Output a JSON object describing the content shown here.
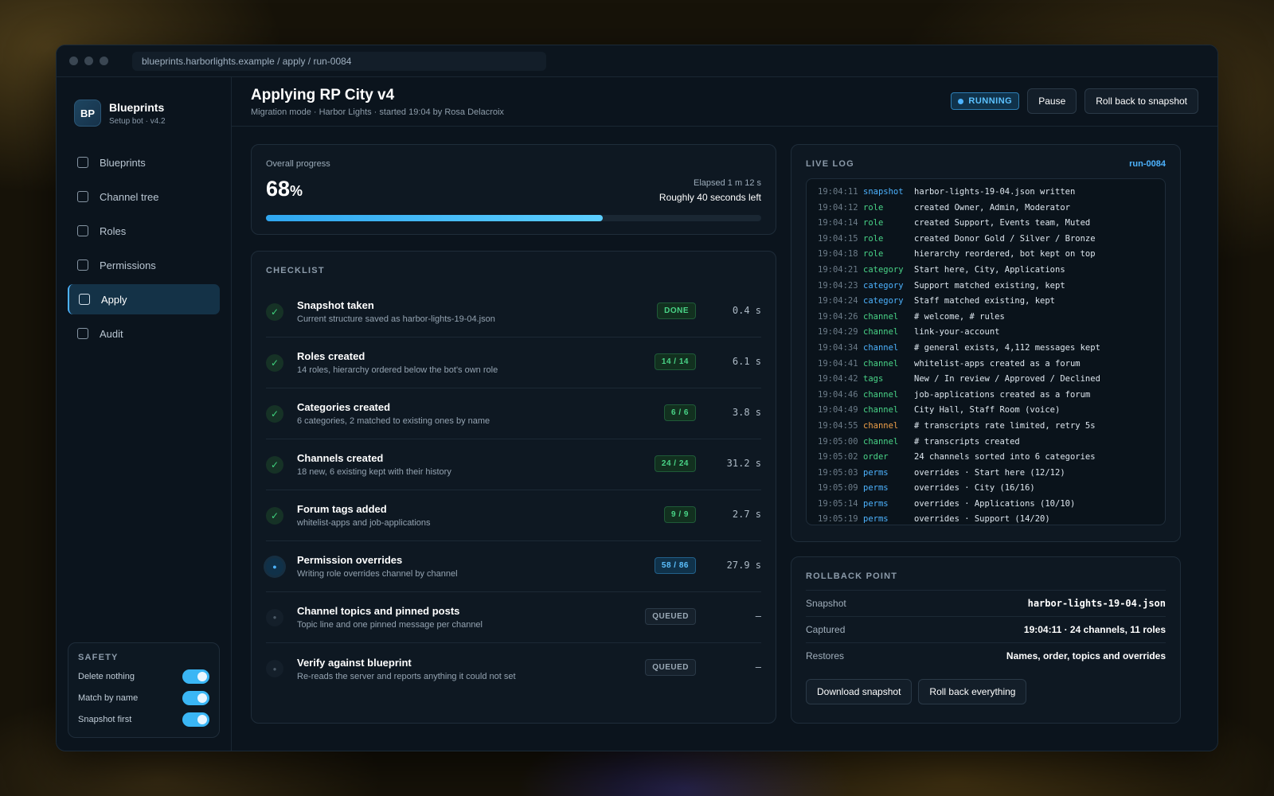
{
  "browser": {
    "url": "blueprints.harborlights.example / apply / run-0084"
  },
  "brand": {
    "logo": "BP",
    "name": "Blueprints",
    "subtitle": "Setup bot · v4.2"
  },
  "nav": [
    {
      "label": "Blueprints",
      "icon": "square-icon",
      "active": false
    },
    {
      "label": "Channel tree",
      "icon": "square-icon",
      "active": false
    },
    {
      "label": "Roles",
      "icon": "square-icon",
      "active": false
    },
    {
      "label": "Permissions",
      "icon": "square-icon",
      "active": false
    },
    {
      "label": "Apply",
      "icon": "square-icon",
      "active": true
    },
    {
      "label": "Audit",
      "icon": "square-icon",
      "active": false
    }
  ],
  "safety": {
    "title": "SAFETY",
    "toggles": [
      {
        "label": "Delete nothing",
        "on": true
      },
      {
        "label": "Match by name",
        "on": true
      },
      {
        "label": "Snapshot first",
        "on": true
      }
    ]
  },
  "header": {
    "title": "Applying RP City v4",
    "subtitle": "Migration mode · Harbor Lights · started 19:04 by Rosa Delacroix",
    "status": "RUNNING",
    "pause_label": "Pause",
    "rollback_label": "Roll back to snapshot"
  },
  "progress": {
    "label": "Overall progress",
    "value": "68",
    "unit": "%",
    "fraction": 0.68,
    "elapsed": "Elapsed 1 m 12 s",
    "remaining": "Roughly 40 seconds left"
  },
  "checklist": {
    "title": "CHECKLIST",
    "items": [
      {
        "title": "Snapshot taken",
        "desc": "Current structure saved as harbor-lights-19-04.json",
        "pill": "DONE",
        "state": "done",
        "duration": "0.4 s"
      },
      {
        "title": "Roles created",
        "desc": "14 roles, hierarchy ordered below the bot's own role",
        "pill": "14 / 14",
        "state": "done",
        "duration": "6.1 s"
      },
      {
        "title": "Categories created",
        "desc": "6 categories, 2 matched to existing ones by name",
        "pill": "6 / 6",
        "state": "done",
        "duration": "3.8 s"
      },
      {
        "title": "Channels created",
        "desc": "18 new, 6 existing kept with their history",
        "pill": "24 / 24",
        "state": "done",
        "duration": "31.2 s"
      },
      {
        "title": "Forum tags added",
        "desc": "whitelist-apps and job-applications",
        "pill": "9 / 9",
        "state": "done",
        "duration": "2.7 s"
      },
      {
        "title": "Permission overrides",
        "desc": "Writing role overrides channel by channel",
        "pill": "58 / 86",
        "state": "running",
        "duration": "27.9 s"
      },
      {
        "title": "Channel topics and pinned posts",
        "desc": "Topic line and one pinned message per channel",
        "pill": "QUEUED",
        "state": "queued",
        "duration": "–"
      },
      {
        "title": "Verify against blueprint",
        "desc": "Re-reads the server and reports anything it could not set",
        "pill": "QUEUED",
        "state": "queued",
        "duration": "–"
      }
    ]
  },
  "log": {
    "title": "LIVE LOG",
    "run_id": "run-0084",
    "kind_colors": {
      "snapshot": "#4db3ff",
      "role": "#49d487",
      "category": "#4db3ff",
      "channel": "#49d487",
      "channel-warn": "#f0a048",
      "tags": "#49d487",
      "order": "#49d487",
      "perms": "#4db3ff"
    },
    "lines": [
      {
        "time": "19:04:11",
        "kind": "snapshot",
        "color": "snapshot",
        "msg": "harbor-lights-19-04.json written"
      },
      {
        "time": "19:04:12",
        "kind": "role",
        "color": "role",
        "msg": "created Owner, Admin, Moderator"
      },
      {
        "time": "19:04:14",
        "kind": "role",
        "color": "role",
        "msg": "created Support, Events team, Muted"
      },
      {
        "time": "19:04:15",
        "kind": "role",
        "color": "role",
        "msg": "created Donor Gold / Silver / Bronze"
      },
      {
        "time": "19:04:18",
        "kind": "role",
        "color": "role",
        "msg": "hierarchy reordered, bot kept on top"
      },
      {
        "time": "19:04:21",
        "kind": "category",
        "color": "role",
        "msg": "Start here, City, Applications"
      },
      {
        "time": "19:04:23",
        "kind": "category",
        "color": "category",
        "msg": "Support matched existing, kept"
      },
      {
        "time": "19:04:24",
        "kind": "category",
        "color": "category",
        "msg": "Staff matched existing, kept"
      },
      {
        "time": "19:04:26",
        "kind": "channel",
        "color": "channel",
        "msg": "# welcome, # rules"
      },
      {
        "time": "19:04:29",
        "kind": "channel",
        "color": "channel",
        "msg": "link-your-account"
      },
      {
        "time": "19:04:34",
        "kind": "channel",
        "color": "category",
        "msg": "# general exists, 4,112 messages kept"
      },
      {
        "time": "19:04:41",
        "kind": "channel",
        "color": "channel",
        "msg": "whitelist-apps created as a forum"
      },
      {
        "time": "19:04:42",
        "kind": "tags",
        "color": "tags",
        "msg": "New / In review / Approved / Declined"
      },
      {
        "time": "19:04:46",
        "kind": "channel",
        "color": "channel",
        "msg": "job-applications created as a forum"
      },
      {
        "time": "19:04:49",
        "kind": "channel",
        "color": "channel",
        "msg": "City Hall, Staff Room (voice)"
      },
      {
        "time": "19:04:55",
        "kind": "channel",
        "color": "channel-warn",
        "msg": "# transcripts rate limited, retry 5s"
      },
      {
        "time": "19:05:00",
        "kind": "channel",
        "color": "channel",
        "msg": "# transcripts created"
      },
      {
        "time": "19:05:02",
        "kind": "order",
        "color": "order",
        "msg": "24 channels sorted into 6 categories"
      },
      {
        "time": "19:05:03",
        "kind": "perms",
        "color": "perms",
        "msg": "overrides · Start here (12/12)"
      },
      {
        "time": "19:05:09",
        "kind": "perms",
        "color": "perms",
        "msg": "overrides · City (16/16)"
      },
      {
        "time": "19:05:14",
        "kind": "perms",
        "color": "perms",
        "msg": "overrides · Applications (10/10)"
      },
      {
        "time": "19:05:19",
        "kind": "perms",
        "color": "perms",
        "msg": "overrides · Support (14/20)"
      }
    ]
  },
  "rollback": {
    "title": "ROLLBACK POINT",
    "rows": [
      {
        "key": "Snapshot",
        "value": "harbor-lights-19-04.json",
        "mono": true
      },
      {
        "key": "Captured",
        "value": "19:04:11 · 24 channels, 11 roles",
        "mono": false
      },
      {
        "key": "Restores",
        "value": "Names, order, topics and overrides",
        "mono": false
      }
    ],
    "download_label": "Download snapshot",
    "rollback_label": "Roll back everything"
  }
}
